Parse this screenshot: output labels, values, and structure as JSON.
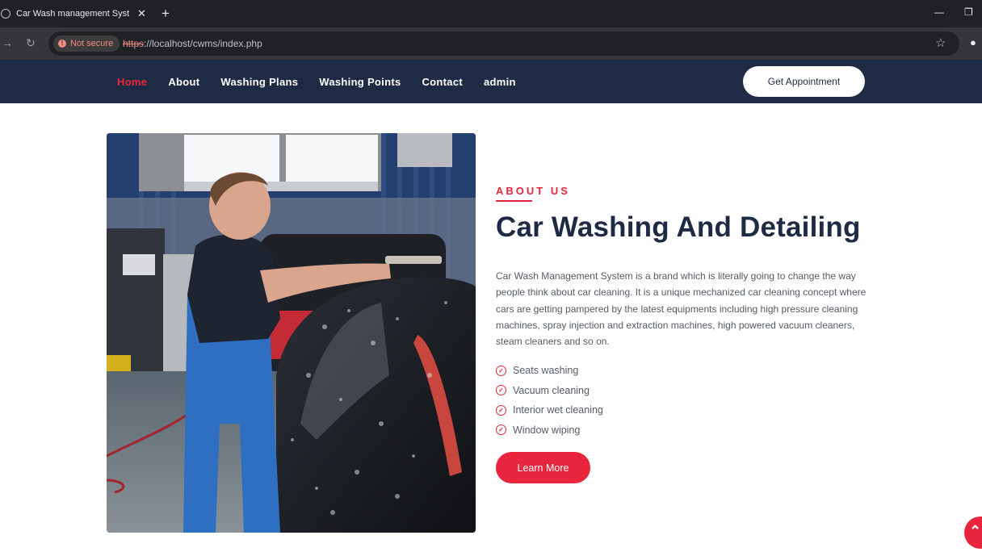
{
  "browser": {
    "tab_title": "Car Wash management System",
    "secure_label": "Not secure",
    "url_scheme": "https",
    "url_rest": "://localhost/cwms/index.php"
  },
  "nav": {
    "items": [
      {
        "label": "Home",
        "active": true
      },
      {
        "label": "About",
        "active": false
      },
      {
        "label": "Washing Plans",
        "active": false
      },
      {
        "label": "Washing Points",
        "active": false
      },
      {
        "label": "Contact",
        "active": false
      },
      {
        "label": "admin",
        "active": false
      }
    ],
    "appointment_button": "Get Appointment"
  },
  "about": {
    "eyebrow": "ABOUT US",
    "heading": "Car Washing And Detailing",
    "paragraph": "Car Wash Management System is a brand which is literally going to change the way people think about car cleaning. It is a unique mechanized car cleaning concept where cars are getting pampered by the latest equipments including high pressure cleaning machines, spray injection and extraction machines, high powered vacuum cleaners, steam cleaners and so on.",
    "features": [
      "Seats washing",
      "Vacuum cleaning",
      "Interior wet cleaning",
      "Window wiping"
    ],
    "button": "Learn More"
  },
  "colors": {
    "accent": "#e8253c",
    "navy": "#1f2a44"
  },
  "icons": {
    "scroll_top": "chevron-up-icon",
    "feature_check": "check-circle-icon"
  }
}
